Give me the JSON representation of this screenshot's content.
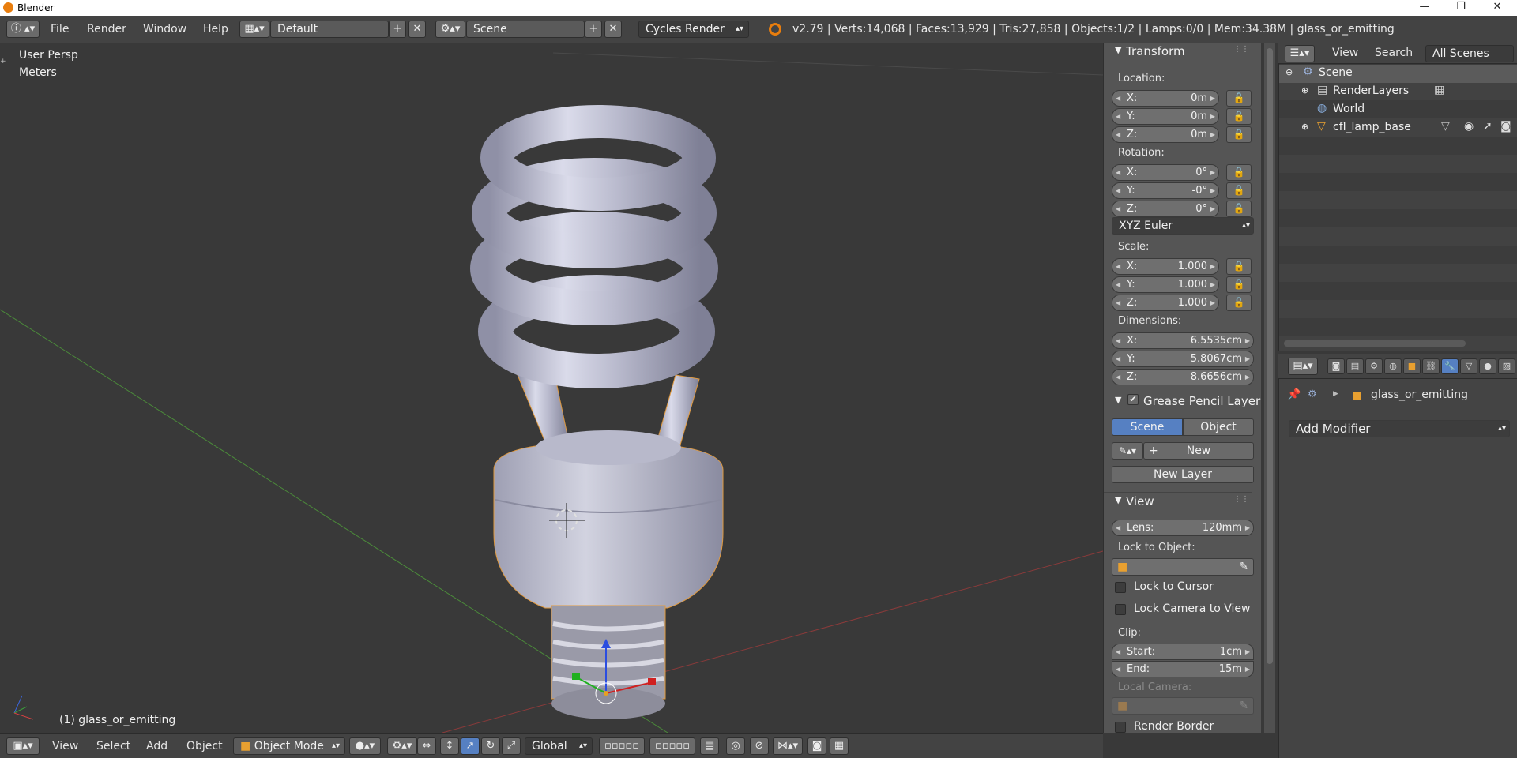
{
  "window": {
    "title": "Blender",
    "minimize": "—",
    "restore": "❐",
    "close": "✕"
  },
  "topbar": {
    "menus": [
      "File",
      "Render",
      "Window",
      "Help"
    ],
    "layout_name": "Default",
    "scene_name": "Scene",
    "render_engine": "Cycles Render",
    "stats": "v2.79 | Verts:14,068 | Faces:13,929 | Tris:27,858 | Objects:1/2 | Lamps:0/0 | Mem:34.38M | glass_or_emitting"
  },
  "viewport": {
    "view_name": "User Persp",
    "units": "Meters",
    "active_object_label": "(1) glass_or_emitting"
  },
  "bottombar": {
    "menus": [
      "View",
      "Select",
      "Add",
      "Object"
    ],
    "mode": "Object Mode",
    "orientation": "Global"
  },
  "npanel": {
    "transform_title": "Transform",
    "location_label": "Location:",
    "location": [
      {
        "axis": "X:",
        "value": "0m"
      },
      {
        "axis": "Y:",
        "value": "0m"
      },
      {
        "axis": "Z:",
        "value": "0m"
      }
    ],
    "rotation_label": "Rotation:",
    "rotation": [
      {
        "axis": "X:",
        "value": "0°"
      },
      {
        "axis": "Y:",
        "value": "-0°"
      },
      {
        "axis": "Z:",
        "value": "0°"
      }
    ],
    "rotation_mode": "XYZ Euler",
    "scale_label": "Scale:",
    "scale": [
      {
        "axis": "X:",
        "value": "1.000"
      },
      {
        "axis": "Y:",
        "value": "1.000"
      },
      {
        "axis": "Z:",
        "value": "1.000"
      }
    ],
    "dimensions_label": "Dimensions:",
    "dimensions": [
      {
        "axis": "X:",
        "value": "6.5535cm"
      },
      {
        "axis": "Y:",
        "value": "5.8067cm"
      },
      {
        "axis": "Z:",
        "value": "8.6656cm"
      }
    ],
    "grease_title": "Grease Pencil Layer",
    "scene_tab": "Scene",
    "object_tab": "Object",
    "new_label": "New",
    "new_layer_label": "New Layer",
    "view_title": "View",
    "lens_label": "Lens:",
    "lens_value": "120mm",
    "lock_to_object_label": "Lock to Object:",
    "lock_to_cursor": "Lock to Cursor",
    "lock_camera": "Lock Camera to View",
    "clip_label": "Clip:",
    "clip_start_label": "Start:",
    "clip_start": "1cm",
    "clip_end_label": "End:",
    "clip_end": "15m",
    "local_camera_label": "Local Camera:",
    "render_border": "Render Border"
  },
  "outliner": {
    "view_menu": "View",
    "search_menu": "Search",
    "filter": "All Scenes",
    "rows": [
      "Scene",
      "RenderLayers",
      "World",
      "cfl_lamp_base"
    ]
  },
  "properties": {
    "object_name": "glass_or_emitting",
    "add_modifier": "Add Modifier"
  }
}
